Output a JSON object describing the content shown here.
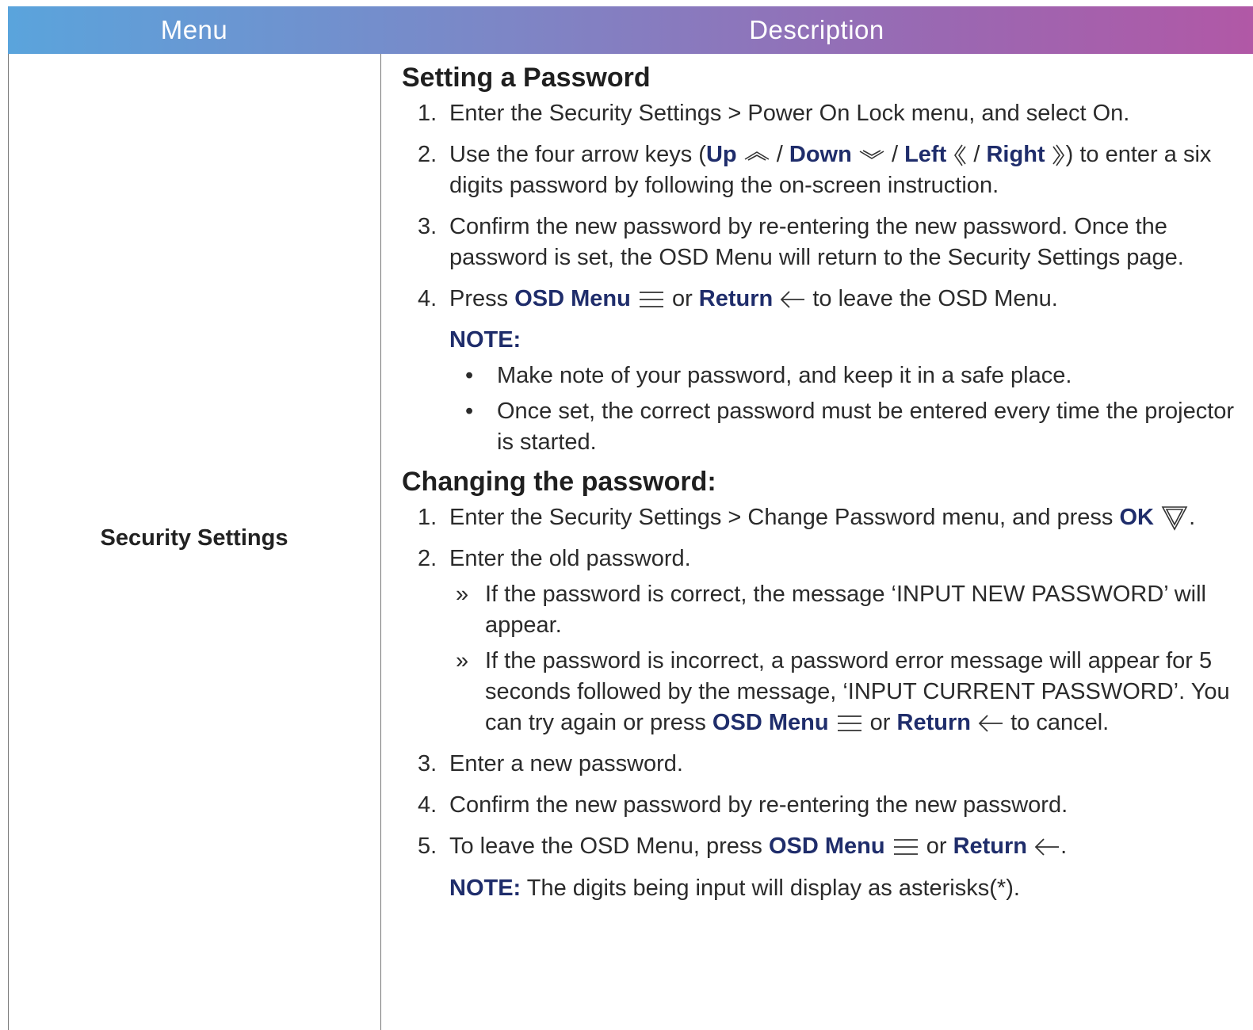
{
  "header": {
    "menu": "Menu",
    "description": "Description"
  },
  "menu_label": "Security Settings",
  "sec1": {
    "title": "Setting a Password",
    "s1": {
      "num": "1.",
      "text": "Enter the Security Settings > Power On Lock menu, and select On."
    },
    "s2": {
      "num": "2.",
      "t1": "Use the four arrow keys (",
      "up": "Up",
      "sep": " / ",
      "down": "Down",
      "left": "Left",
      "right": "Right",
      "t2": ") to enter a six digits password by following the on-screen instruction."
    },
    "s3": {
      "num": "3.",
      "text": "Confirm the new password by re-entering the new password. Once the password is set, the OSD Menu will return to the Security Settings page."
    },
    "s4": {
      "num": "4.",
      "t1": "Press ",
      "osd": "OSD Menu",
      "or": " or ",
      "ret": "Return",
      "t2": " to leave the OSD Menu."
    },
    "note_label": "NOTE:",
    "bullet1": "Make note of your password, and keep it in a safe place.",
    "bullet2": "Once set, the correct password must be entered every time the projector is started."
  },
  "sec2": {
    "title": "Changing the password:",
    "s1": {
      "num": "1.",
      "text": "Enter the Security Settings > Change Password menu, and press ",
      "ok": "OK",
      "end": "."
    },
    "s2": {
      "num": "2.",
      "text": "Enter the old password."
    },
    "sub1": "If the password is correct, the message ‘INPUT NEW PASSWORD’ will appear.",
    "sub2": {
      "t1": "If the password is incorrect, a password error message will appear for 5 seconds followed by the message, ‘INPUT CURRENT PASSWORD’. You can try again or press ",
      "osd": "OSD Menu",
      "or": " or ",
      "ret": "Return",
      "t2": " to cancel."
    },
    "s3": {
      "num": "3.",
      "text": "Enter a new password."
    },
    "s4": {
      "num": "4.",
      "text": "Confirm the new password by re-entering the new password."
    },
    "s5": {
      "num": "5.",
      "t1": "To leave the OSD Menu, press ",
      "osd": "OSD Menu",
      "or": " or ",
      "ret": "Return",
      "end": "."
    },
    "note_label": "NOTE:",
    "note_text": "  The digits being input will display as asterisks(*)."
  },
  "glyphs": {
    "bullet": "•",
    "sub_mark": "»"
  },
  "colors": {
    "accent": "#1f2d6b",
    "header_start": "#5aa4dc",
    "header_end": "#b158a6"
  }
}
